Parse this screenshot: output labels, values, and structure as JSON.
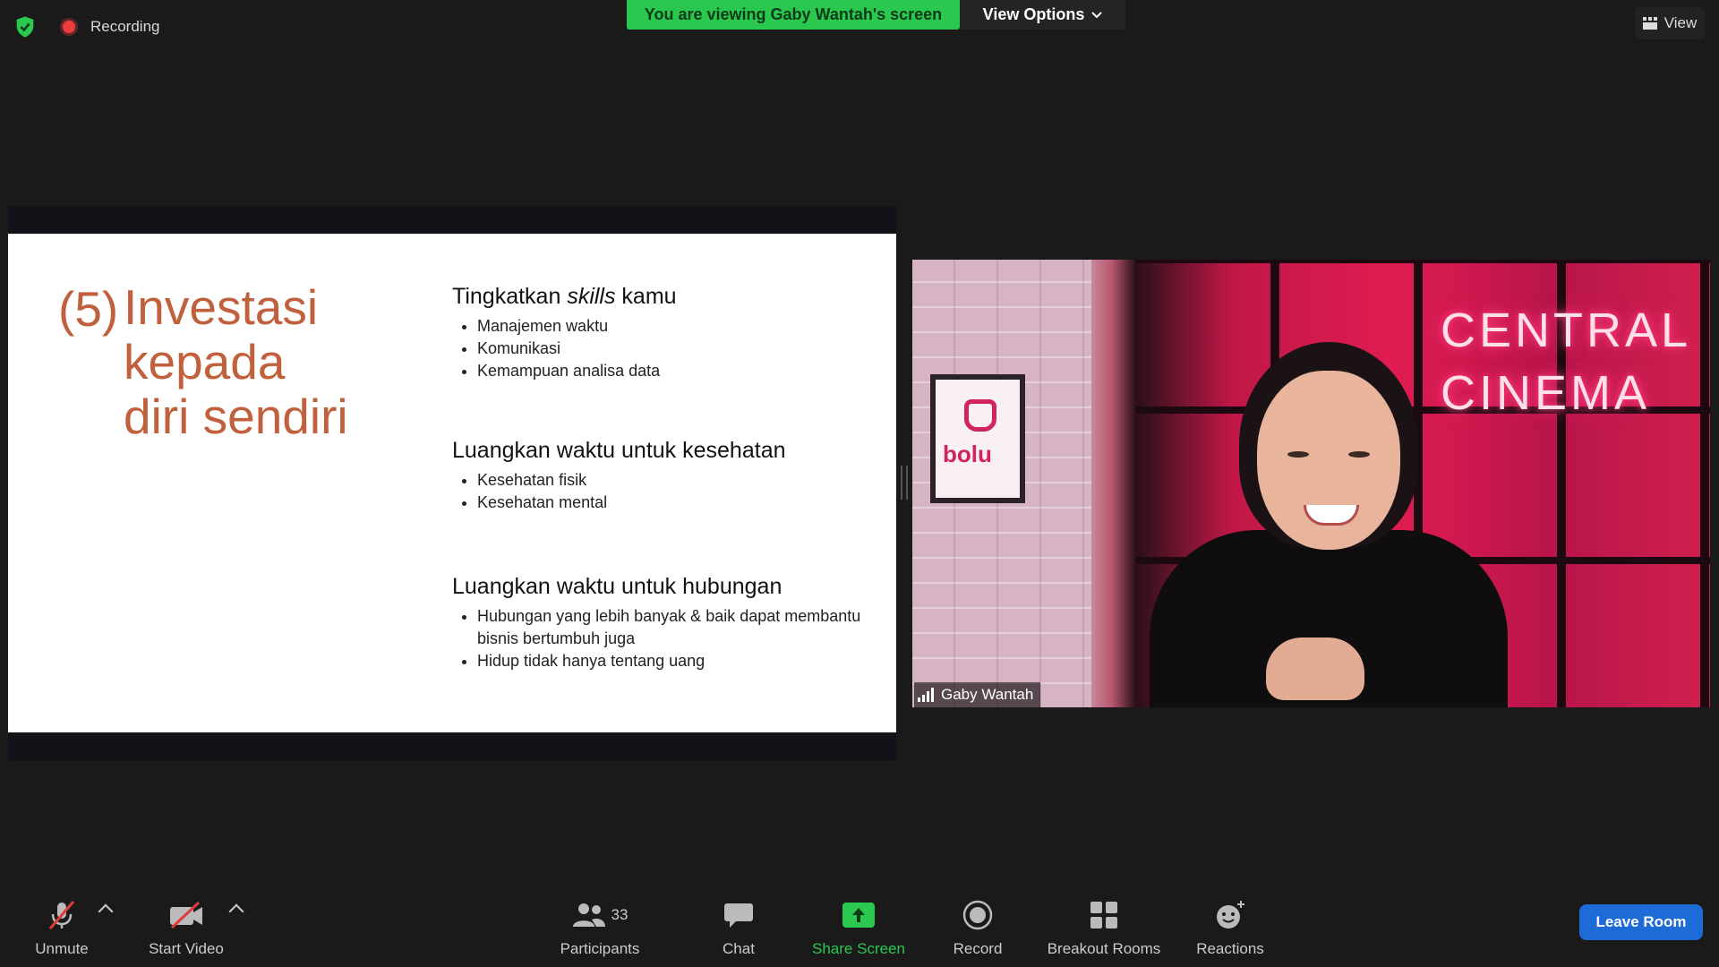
{
  "top": {
    "recording_label": "Recording",
    "viewing_banner": "You are viewing Gaby Wantah's screen",
    "view_options_label": "View Options",
    "view_button_label": "View"
  },
  "slide": {
    "number": "(5)",
    "title_lines": [
      "Investasi",
      "kepada",
      "diri sendiri"
    ],
    "sections": [
      {
        "heading_prefix": "Tingkatkan ",
        "heading_italic": "skills",
        "heading_suffix": " kamu",
        "items": [
          "Manajemen waktu",
          "Komunikasi",
          "Kemampuan analisa data"
        ]
      },
      {
        "heading": "Luangkan waktu untuk kesehatan",
        "items": [
          "Kesehatan fisik",
          "Kesehatan mental"
        ]
      },
      {
        "heading": "Luangkan waktu untuk hubungan",
        "items": [
          "Hubungan yang lebih banyak & baik dapat membantu bisnis bertumbuh juga",
          "Hidup tidak hanya tentang uang"
        ]
      }
    ]
  },
  "video": {
    "participant_name": "Gaby Wantah",
    "background_poster_text": "bolu",
    "background_neon_lines": [
      "CENTRAL",
      "CINEMA"
    ]
  },
  "toolbar": {
    "unmute_label": "Unmute",
    "start_video_label": "Start Video",
    "participants_label": "Participants",
    "participants_count": "33",
    "chat_label": "Chat",
    "share_screen_label": "Share Screen",
    "record_label": "Record",
    "breakout_rooms_label": "Breakout Rooms",
    "reactions_label": "Reactions",
    "leave_label": "Leave Room"
  },
  "colors": {
    "banner_green": "#2ac84f",
    "slide_accent": "#c0603c",
    "leave_blue": "#1d6bd6",
    "recording_red": "#ee3b3b"
  }
}
